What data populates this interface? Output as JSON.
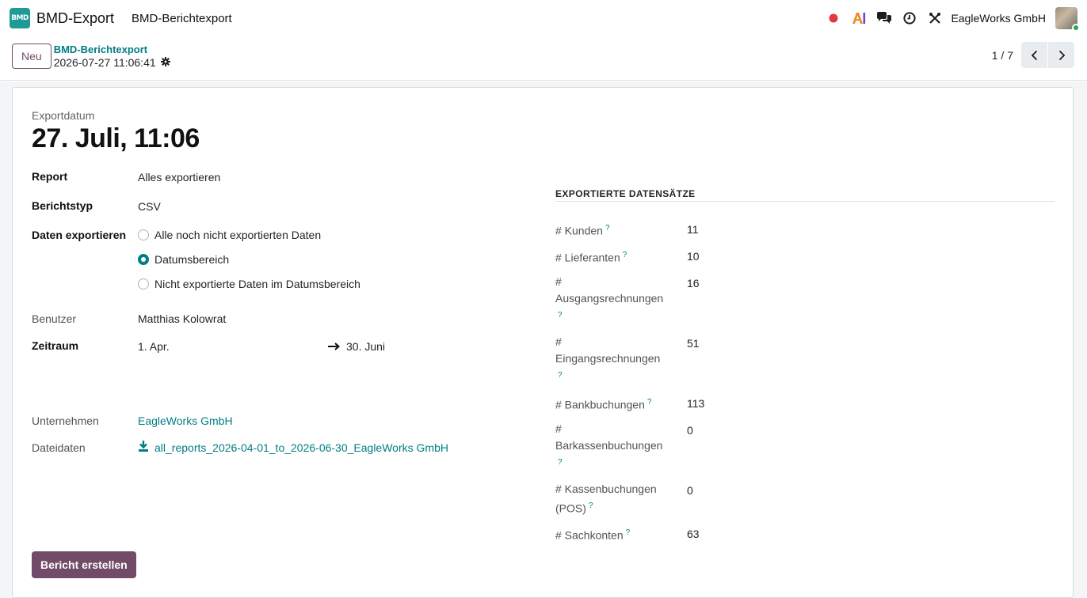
{
  "app": {
    "icon_text": "BMD",
    "name": "BMD-Export",
    "menu_item": "BMD-Berichtexport",
    "company": "EagleWorks GmbH",
    "colors": {
      "brand": "#714b67",
      "accent": "#017e84",
      "app_icon": "#1f9b97"
    }
  },
  "systray": {
    "icons": [
      "record-dot-icon",
      "ai-icon",
      "chat-icon",
      "clock-icon",
      "tools-icon"
    ]
  },
  "control": {
    "new_label": "Neu",
    "breadcrumb": "BMD-Berichtexport",
    "record_name": "2026-07-27 11:06:41",
    "pager_value": "1 / 7"
  },
  "form": {
    "export_date_label": "Exportdatum",
    "export_date_value": "27. Juli, 11:06",
    "report_label": "Report",
    "report_value": "Alles exportieren",
    "type_label": "Berichtstyp",
    "type_value": "CSV",
    "export_mode_label": "Daten exportieren",
    "export_mode_options": [
      "Alle noch nicht exportierten Daten",
      "Datumsbereich",
      "Nicht exportierte Daten im Datumsbereich"
    ],
    "export_mode_selected": "Datumsbereich",
    "user_label": "Benutzer",
    "user_value": "Matthias Kolowrat",
    "period_label": "Zeitraum",
    "period_from": "1. Apr.",
    "period_to": "30. Juni",
    "company_label": "Unternehmen",
    "company_value": "EagleWorks GmbH",
    "file_label": "Dateidaten",
    "file_value": "all_reports_2026-04-01_to_2026-06-30_EagleWorks GmbH",
    "generate_label": "Bericht erstellen"
  },
  "stats": {
    "title": "EXPORTIERTE DATENSÄTZE",
    "help_mark": "?",
    "rows": [
      {
        "line1": "# Kunden",
        "line2": "",
        "value": "11"
      },
      {
        "line1": "# Lieferanten",
        "line2": "",
        "value": "10"
      },
      {
        "line1": "#",
        "line2": "Ausgangsrechnungen",
        "value": "16"
      },
      {
        "line1": "#",
        "line2": "Eingangsrechnungen",
        "value": "51"
      },
      {
        "line1": "# Bankbuchungen",
        "line2": "",
        "value": "113"
      },
      {
        "line1": "#",
        "line2": "Barkassenbuchungen",
        "value": "0"
      },
      {
        "line1": "# Kassenbuchungen",
        "line2": "(POS)",
        "value": "0"
      },
      {
        "line1": "# Sachkonten",
        "line2": "",
        "value": "63"
      }
    ]
  }
}
